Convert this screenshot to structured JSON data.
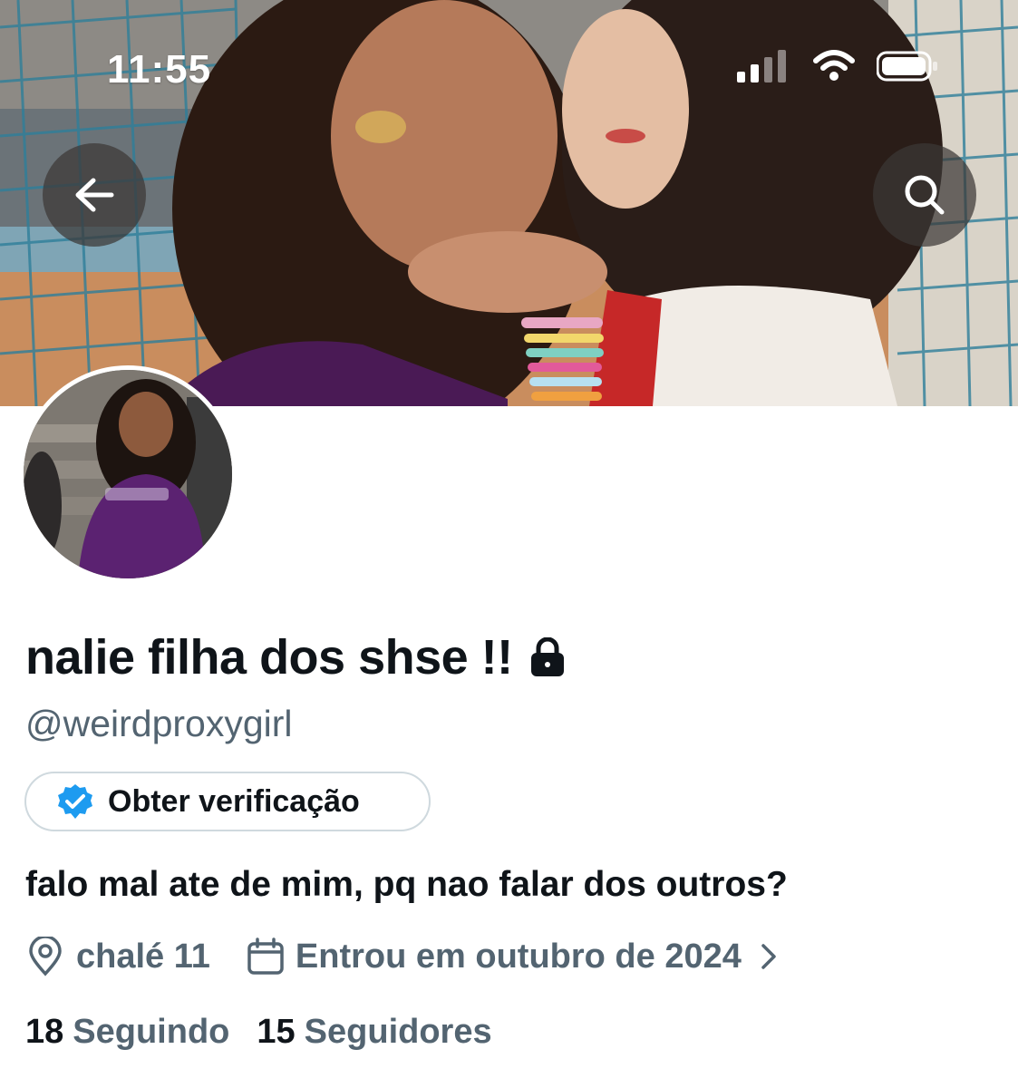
{
  "status_bar": {
    "time": "11:55",
    "icons": [
      "cellular-signal-icon",
      "wifi-icon",
      "battery-icon"
    ]
  },
  "header": {
    "back_icon": "arrow-left-icon",
    "search_icon": "search-icon"
  },
  "profile": {
    "display_name": "nalie filha dos shse !!",
    "protected_icon": "lock-icon",
    "handle": "@weirdproxygirl",
    "verification_button_label": "Obter verificação",
    "verification_icon": "verified-badge-icon",
    "bio": "falo mal ate de mim, pq nao falar dos outros?",
    "location": "chalé 11",
    "joined": "Entrou em outubro de 2024",
    "following_count": "18",
    "following_label": "Seguindo",
    "followers_count": "15",
    "followers_label": "Seguidores"
  },
  "colors": {
    "text_primary": "#0f1419",
    "text_secondary": "#536471",
    "verified_blue": "#1d9bf0",
    "border": "#cfd9de"
  }
}
